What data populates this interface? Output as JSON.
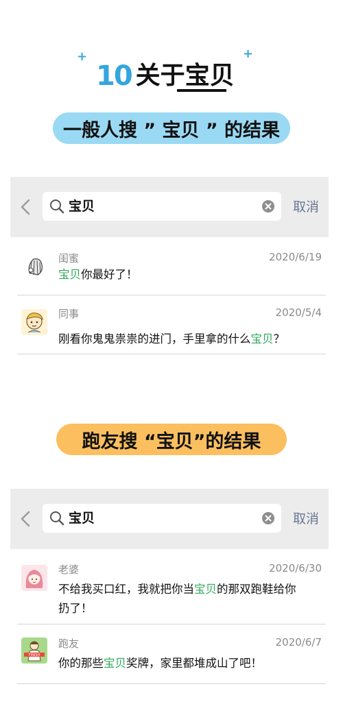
{
  "header": {
    "number": "10",
    "title_prefix": "关于",
    "title_highlight": "宝贝",
    "plus_sign": "+"
  },
  "section1": {
    "pill_label": "一般人搜 ” 宝贝 ” 的结果",
    "pill_color": "#9ad9f3",
    "search": {
      "query": "宝贝",
      "cancel_label": "取消"
    },
    "results": [
      {
        "contact": "闺蜜",
        "date": "2020/6/19",
        "msg_before": "",
        "msg_keyword": "宝贝",
        "msg_after": "你最好了！",
        "msg_after2": ""
      },
      {
        "contact": "同事",
        "date": "2020/5/4",
        "msg_before": "刚看你鬼鬼祟祟的进门，手里拿的什么",
        "msg_keyword": "宝贝",
        "msg_after": "？",
        "msg_after2": ""
      }
    ]
  },
  "section2": {
    "pill_label": "跑友搜 “宝贝”的结果",
    "pill_color": "#fbbf5f",
    "search": {
      "query": "宝贝",
      "cancel_label": "取消"
    },
    "results": [
      {
        "contact": "老婆",
        "date": "2020/6/30",
        "msg_before": "不给我买口红，我就把你当",
        "msg_keyword": "宝贝",
        "msg_after": "的那双跑鞋给你",
        "msg_after2": "扔了！"
      },
      {
        "contact": "跑友",
        "date": "2020/6/7",
        "msg_before": "你的那些",
        "msg_keyword": "宝贝",
        "msg_after": "奖牌，家里都堆成山了吧！",
        "msg_after2": ""
      }
    ]
  },
  "colors": {
    "accent_blue": "#35a6dd",
    "highlight_green": "#2fa85a",
    "cancel_color": "#6b7791"
  }
}
